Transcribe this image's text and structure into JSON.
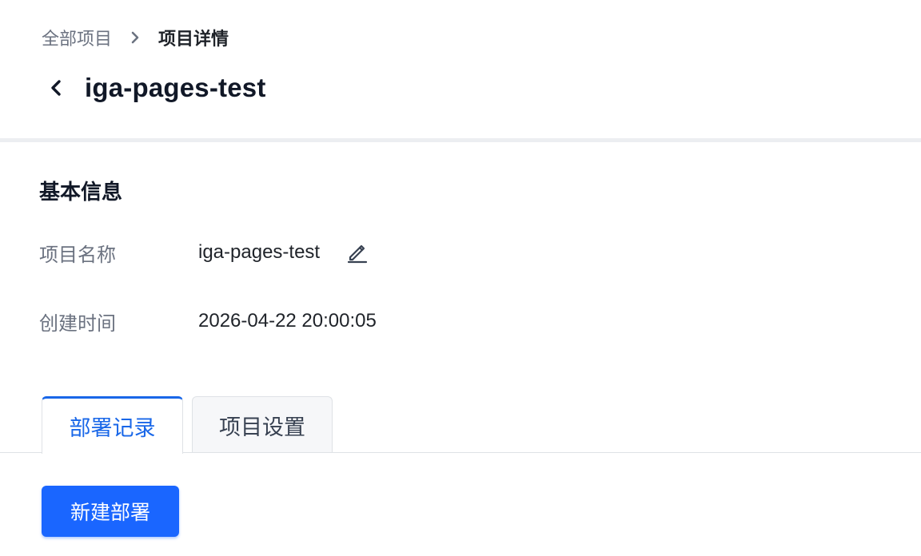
{
  "breadcrumb": {
    "parent": "全部项目",
    "current": "项目详情"
  },
  "project": {
    "title": "iga-pages-test"
  },
  "basic_info": {
    "section_title": "基本信息",
    "name_label": "项目名称",
    "name_value": "iga-pages-test",
    "created_label": "创建时间",
    "created_value": "2026-04-22 20:00:05"
  },
  "tabs": [
    {
      "label": "部署记录",
      "active": true
    },
    {
      "label": "项目设置",
      "active": false
    }
  ],
  "actions": {
    "new_deploy_label": "新建部署"
  },
  "colors": {
    "accent": "#1a66ff",
    "tab_active_text": "#1967e8",
    "muted_text": "#6b7280"
  },
  "icons": {
    "breadcrumb_separator": "chevron-right-icon",
    "back": "chevron-left-icon",
    "edit": "pencil-icon"
  }
}
